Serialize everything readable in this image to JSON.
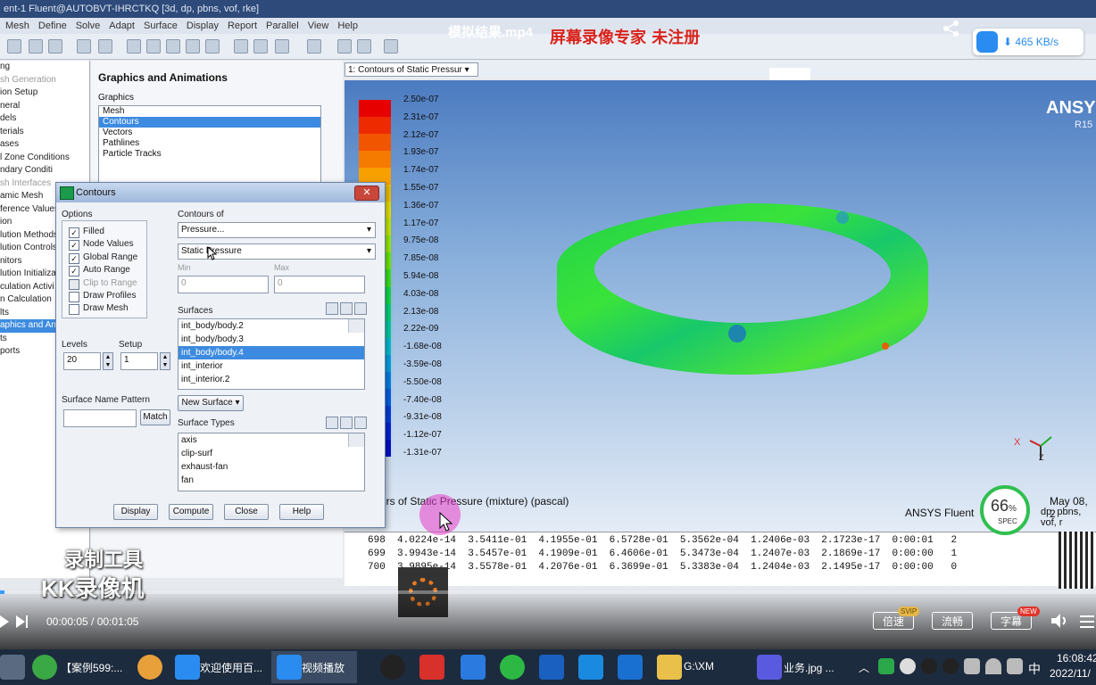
{
  "window": {
    "title": "ent-1 Fluent@AUTOBVT-IHRCTKQ  [3d, dp, pbns, vof, rke]",
    "menu": [
      "Mesh",
      "Define",
      "Solve",
      "Adapt",
      "Surface",
      "Display",
      "Report",
      "Parallel",
      "View",
      "Help"
    ]
  },
  "overlay": {
    "video_title": "模拟结果.mp4",
    "recorder_watermark": "屏幕录像专家  未注册",
    "speed": "465 KB/s",
    "tool_line1": "录制工具",
    "tool_line2": "KK录像机",
    "fps_value": "66",
    "fps_unit": "%",
    "fps_label": "SPEC"
  },
  "tree": {
    "items": [
      "ng",
      "sh Generation",
      "ion Setup",
      "neral",
      "dels",
      "terials",
      "ases",
      "l Zone Conditions",
      "ndary Conditi",
      "sh Interfaces",
      "amic Mesh",
      "ference Values",
      "ion",
      "lution Methods",
      "lution Controls",
      "nitors",
      "lution Initializa",
      "culation Activi",
      "n Calculation",
      "lts",
      "aphics and Anim",
      "ts",
      "ports"
    ],
    "selected_index": 20
  },
  "graphics_panel": {
    "heading": "Graphics and Animations",
    "list_label": "Graphics",
    "items": [
      "Mesh",
      "Contours",
      "Vectors",
      "Pathlines",
      "Particle Tracks"
    ],
    "selected_index": 1
  },
  "contours_dialog": {
    "title": "Contours",
    "options_label": "Options",
    "options": [
      {
        "label": "Filled",
        "checked": true,
        "enabled": true
      },
      {
        "label": "Node Values",
        "checked": true,
        "enabled": true
      },
      {
        "label": "Global Range",
        "checked": true,
        "enabled": true
      },
      {
        "label": "Auto Range",
        "checked": true,
        "enabled": true
      },
      {
        "label": "Clip to Range",
        "checked": false,
        "enabled": false
      },
      {
        "label": "Draw Profiles",
        "checked": false,
        "enabled": true
      },
      {
        "label": "Draw Mesh",
        "checked": false,
        "enabled": true
      }
    ],
    "contours_of_label": "Contours of",
    "contours_of_value": "Pressure...",
    "contours_sub_value": "Static Pressure",
    "min_label": "Min",
    "max_label": "Max",
    "min_value": "0",
    "max_value": "0",
    "surfaces_label": "Surfaces",
    "surfaces": [
      "int_body/body.2",
      "int_body/body.3",
      "int_body/body.4",
      "int_interior",
      "int_interior.2"
    ],
    "surfaces_selected_index": 2,
    "levels_label": "Levels",
    "levels_value": "20",
    "setup_label": "Setup",
    "setup_value": "1",
    "surface_name_pattern_label": "Surface Name Pattern",
    "match_button": "Match",
    "new_surface_button": "New Surface",
    "surface_types_label": "Surface Types",
    "surface_types": [
      "axis",
      "clip-surf",
      "exhaust-fan",
      "fan"
    ],
    "buttons": {
      "display": "Display",
      "compute": "Compute",
      "close": "Close",
      "help": "Help"
    }
  },
  "graphics_window": {
    "tab_label": "1: Contours of Static Pressur",
    "brand": "ANSYS",
    "brand_version": "R15",
    "legend_labels": [
      "2.50e-07",
      "2.31e-07",
      "2.12e-07",
      "1.93e-07",
      "1.74e-07",
      "1.55e-07",
      "1.36e-07",
      "1.17e-07",
      "9.75e-08",
      "7.85e-08",
      "5.94e-08",
      "4.03e-08",
      "2.13e-08",
      "2.22e-09",
      "-1.68e-08",
      "-3.59e-08",
      "-5.50e-08",
      "-7.40e-08",
      "-9.31e-08",
      "-1.12e-07",
      "-1.31e-07"
    ],
    "legend_colors": [
      "#e60000",
      "#ee2a00",
      "#f25500",
      "#f57a00",
      "#f8a000",
      "#f4c400",
      "#e8e400",
      "#c6ee00",
      "#9af000",
      "#6cf000",
      "#3ae81a",
      "#10e048",
      "#00d876",
      "#00d0a4",
      "#00c2d2",
      "#00a4e6",
      "#0082ea",
      "#0060e8",
      "#0040e0",
      "#0024d6",
      "#0010cc"
    ],
    "caption": "urs of Static Pressure (mixture)  (pascal)",
    "caption_right": "ANSYS Fluent",
    "date": "May 08, 2",
    "caption_right2": "dp, pbns, vof, r",
    "axis_x": "X",
    "axis_z": "Z"
  },
  "console": {
    "rows": [
      "698  4.0224e-14  3.5411e-01  4.1955e-01  6.5728e-01  5.3562e-04  1.2406e-03  2.1723e-17  0:00:01   2",
      "699  3.9943e-14  3.5457e-01  4.1909e-01  6.4606e-01  5.3473e-04  1.2407e-03  2.1869e-17  0:00:00   1",
      "700  3.9895e-14  3.5578e-01  4.2076e-01  6.3699e-01  5.3383e-04  1.2404e-03  2.1495e-17  0:00:00   0"
    ]
  },
  "player": {
    "time": "00:00:05 / 00:01:05",
    "progress": 0.004,
    "speed_button": "倍速",
    "svip_badge": "SVIP",
    "quality_button": "流畅",
    "subtitle_button": "字幕",
    "new_badge": "NEW"
  },
  "taskbar": {
    "items": [
      {
        "label": "【案例599:..."
      },
      {
        "label": "欢迎使用百..."
      },
      {
        "label": "视频播放"
      },
      {
        "label": "G:\\XM"
      },
      {
        "label": "业务.jpg ..."
      }
    ],
    "ime": "中",
    "time": "16:08:42",
    "date": "2022/11/"
  },
  "colors": {
    "accent": "#3d8be0",
    "taskbar": "#1d2b3e",
    "title_red": "#d9241c"
  }
}
